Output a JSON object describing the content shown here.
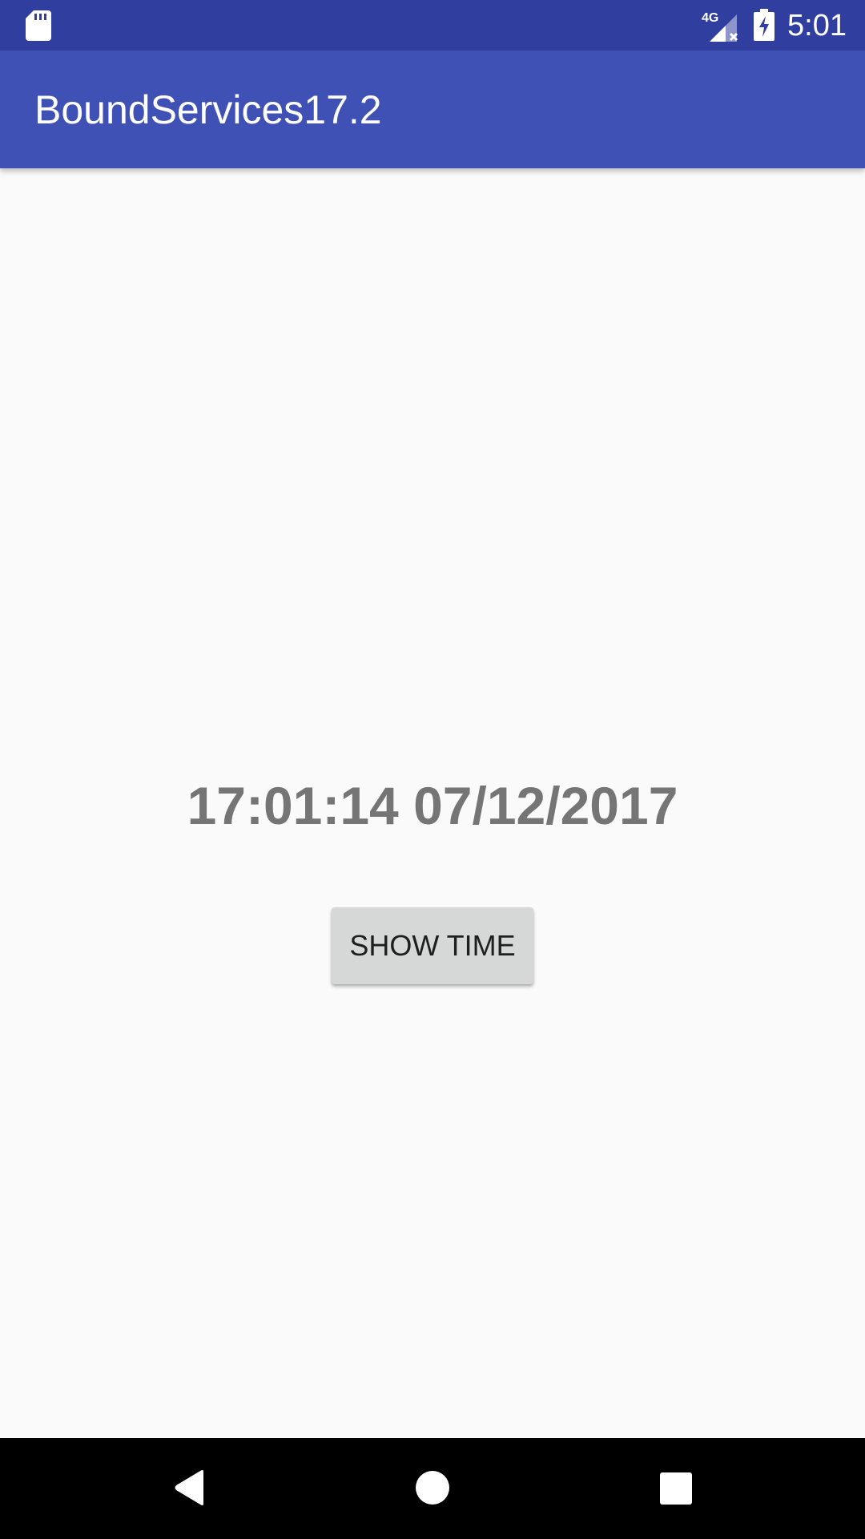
{
  "status_bar": {
    "time": "5:01",
    "network_label": "4G",
    "icons": [
      "sd-card-icon",
      "signal-4g-icon",
      "battery-charging-icon"
    ],
    "background_color": "#303f9f"
  },
  "app_bar": {
    "title": "BoundServices17.2",
    "background_color": "#3f51b5"
  },
  "main": {
    "time_display": "17:01:14 07/12/2017",
    "show_time_button_label": "SHOW TIME"
  },
  "nav_bar": {
    "icons": [
      "back-icon",
      "home-icon",
      "recents-icon"
    ],
    "background_color": "#000000"
  }
}
